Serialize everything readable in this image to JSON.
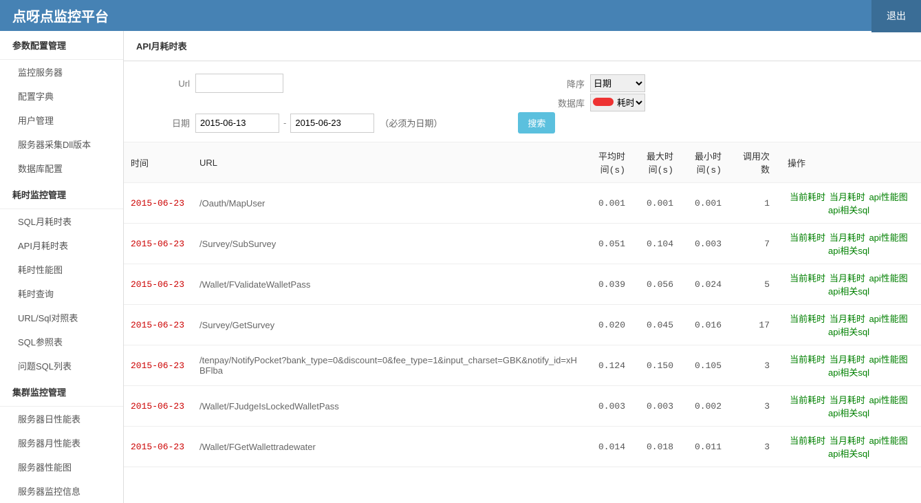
{
  "topbar": {
    "brand": "点呀点监控平台",
    "logout": "退出"
  },
  "sidebar": [
    {
      "title": "参数配置管理",
      "items": [
        "监控服务器",
        "配置字典",
        "用户管理",
        "服务器采集Dll版本",
        "数据库配置"
      ]
    },
    {
      "title": "耗时监控管理",
      "items": [
        "SQL月耗时表",
        "API月耗时表",
        "耗时性能图",
        "耗时查询",
        "URL/Sql对照表",
        "SQL参照表",
        "问题SQL列表"
      ]
    },
    {
      "title": "集群监控管理",
      "items": [
        "服务器日性能表",
        "服务器月性能表",
        "服务器性能图",
        "服务器监控信息"
      ]
    }
  ],
  "page": {
    "title": "API月耗时表"
  },
  "filters": {
    "url_label": "Url",
    "url_value": "",
    "sort_label": "降序",
    "sort_value": "日期",
    "db_label": "数据库",
    "db_value": "耗时",
    "date_label": "日期",
    "date_from": "2015-06-13",
    "date_to": "2015-06-23",
    "date_note": "（必须为日期）",
    "search": "搜索"
  },
  "table": {
    "headers": {
      "time": "时间",
      "url": "URL",
      "avg": "平均时间(s)",
      "max": "最大时间(s)",
      "min": "最小时间(s)",
      "cnt": "调用次数",
      "ops": "操作"
    },
    "ops_links": [
      "当前耗时",
      "当月耗时",
      "api性能图",
      "api相关sql"
    ],
    "rows": [
      {
        "date": "2015-06-23",
        "url": "/Oauth/MapUser",
        "avg": "0.001",
        "max": "0.001",
        "min": "0.001",
        "cnt": "1"
      },
      {
        "date": "2015-06-23",
        "url": "/Survey/SubSurvey",
        "avg": "0.051",
        "max": "0.104",
        "min": "0.003",
        "cnt": "7"
      },
      {
        "date": "2015-06-23",
        "url": "/Wallet/FValidateWalletPass",
        "avg": "0.039",
        "max": "0.056",
        "min": "0.024",
        "cnt": "5"
      },
      {
        "date": "2015-06-23",
        "url": "/Survey/GetSurvey",
        "avg": "0.020",
        "max": "0.045",
        "min": "0.016",
        "cnt": "17"
      },
      {
        "date": "2015-06-23",
        "url": "/tenpay/NotifyPocket?bank_type=0&discount=0&fee_type=1&input_charset=GBK&notify_id=xHBFlba",
        "avg": "0.124",
        "max": "0.150",
        "min": "0.105",
        "cnt": "3"
      },
      {
        "date": "2015-06-23",
        "url": "/Wallet/FJudgeIsLockedWalletPass",
        "avg": "0.003",
        "max": "0.003",
        "min": "0.002",
        "cnt": "3"
      },
      {
        "date": "2015-06-23",
        "url": "/Wallet/FGetWallettradewater",
        "avg": "0.014",
        "max": "0.018",
        "min": "0.011",
        "cnt": "3"
      }
    ]
  }
}
